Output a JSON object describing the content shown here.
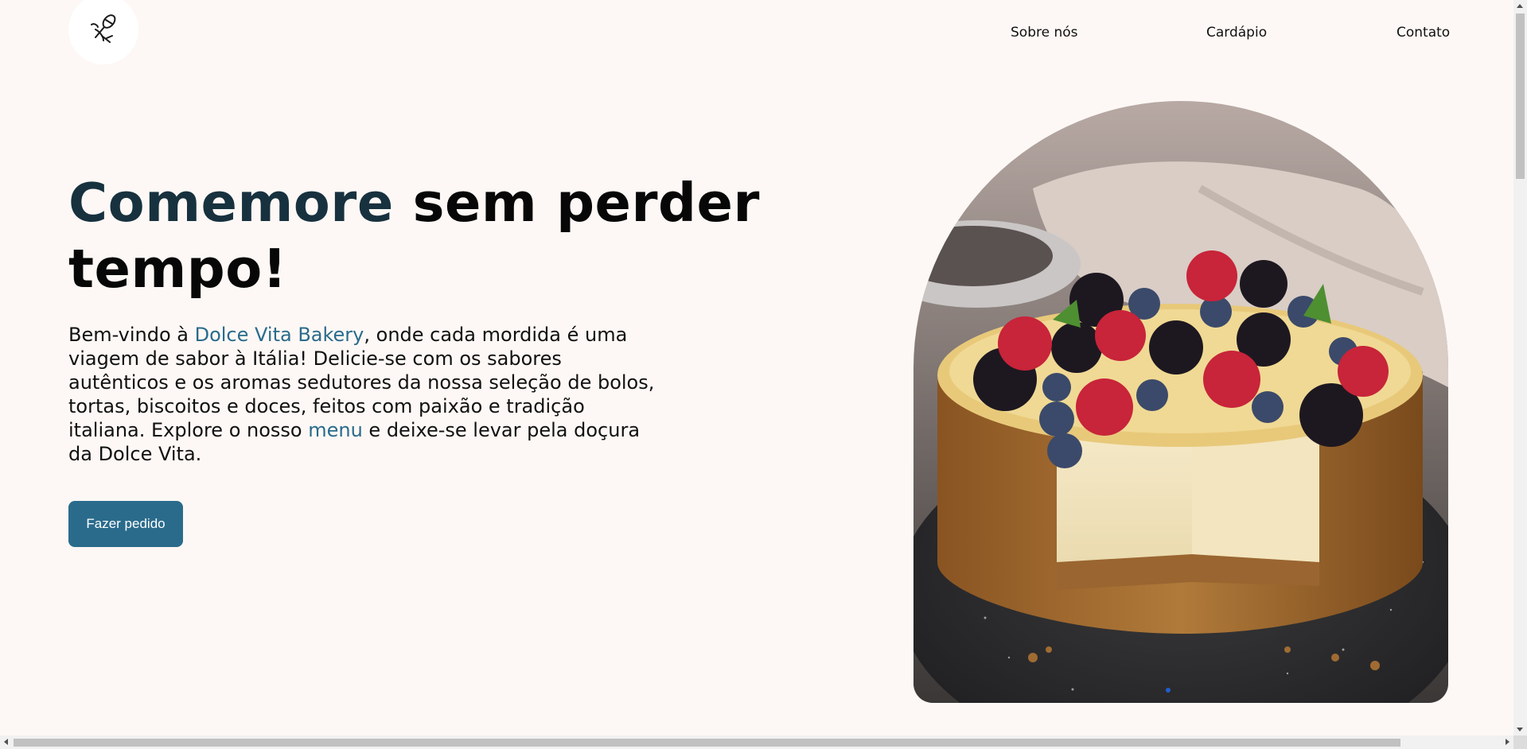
{
  "header": {
    "logo_icon": "whisk-icon",
    "nav": [
      "Sobre nós",
      "Cardápio",
      "Contato"
    ]
  },
  "hero": {
    "title_accent": "Comemore",
    "title_rest_line1": " sem perder",
    "title_line2": "tempo!",
    "desc_part1": "Bem-vindo à ",
    "brand_link": "Dolce Vita Bakery",
    "desc_part2": ", onde cada mordida é uma viagem de sabor à Itália! Delicie-se com os sabores autênticos e os aromas sedutores da nossa seleção de bolos, tortas, biscoitos e doces, feitos com paixão e tradição italiana. Explore o nosso ",
    "menu_link": "menu",
    "desc_part3": " e deixe-se levar pela doçura da Dolce Vita.",
    "cta_label": "Fazer pedido"
  },
  "image": {
    "description_icon": "cheesecake-image"
  },
  "colors": {
    "background": "#fdf8f5",
    "accent_dark": "#17313f",
    "accent_blue": "#2a6b8c"
  }
}
